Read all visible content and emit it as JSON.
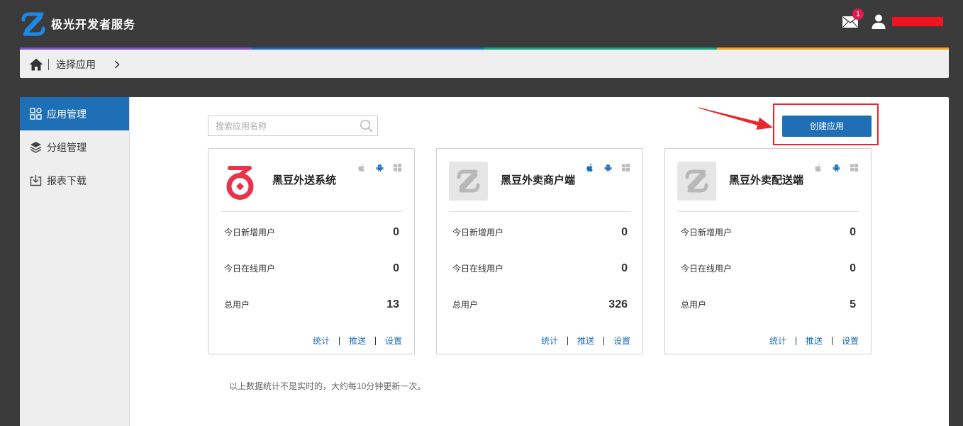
{
  "header": {
    "brand": "极光开发者服务",
    "brand_icon": "jiguang-logo-icon",
    "mail_icon": "mail-icon",
    "notification_badge": "1",
    "user_icon": "user-icon"
  },
  "breadcrumb": {
    "home_icon": "home-icon",
    "current": "选择应用",
    "chevron_icon": "chevron-right-icon"
  },
  "sidebar": {
    "items": [
      {
        "label": "应用管理",
        "icon": "app-grid-icon",
        "active": true
      },
      {
        "label": "分组管理",
        "icon": "layers-icon",
        "active": false
      },
      {
        "label": "报表下载",
        "icon": "download-icon",
        "active": false
      }
    ]
  },
  "search": {
    "placeholder": "搜索应用名称",
    "icon": "search-icon"
  },
  "create_button": {
    "label": "创建应用"
  },
  "apps": [
    {
      "name": "黑豆外送系统",
      "icon": "red-app-logo-icon",
      "platforms": {
        "ios": false,
        "android": true,
        "windows": false
      },
      "stats": [
        {
          "label": "今日新增用户",
          "value": "0"
        },
        {
          "label": "今日在线用户",
          "value": "0"
        },
        {
          "label": "总用户",
          "value": "13"
        }
      ],
      "links": [
        "统计",
        "推送",
        "设置"
      ]
    },
    {
      "name": "黑豆外卖商户端",
      "icon": "placeholder-app-logo-icon",
      "platforms": {
        "ios": true,
        "android": true,
        "windows": false
      },
      "stats": [
        {
          "label": "今日新增用户",
          "value": "0"
        },
        {
          "label": "今日在线用户",
          "value": "0"
        },
        {
          "label": "总用户",
          "value": "326"
        }
      ],
      "links": [
        "统计",
        "推送",
        "设置"
      ]
    },
    {
      "name": "黑豆外卖配送端",
      "icon": "placeholder-app-logo-icon",
      "platforms": {
        "ios": false,
        "android": true,
        "windows": false
      },
      "stats": [
        {
          "label": "今日新增用户",
          "value": "0"
        },
        {
          "label": "今日在线用户",
          "value": "0"
        },
        {
          "label": "总用户",
          "value": "5"
        }
      ],
      "links": [
        "统计",
        "推送",
        "设置"
      ]
    }
  ],
  "note": "以上数据统计不是实时的，大约每10分钟更新一次。",
  "colors": {
    "page_bg": "#3b3b3b",
    "accent_blue": "#1f6fb6",
    "platform_active": "#1f6fb6",
    "platform_inactive": "#bdbdbd",
    "annotation_red": "#e8262b",
    "stripe": [
      "#7e57c2",
      "#1f6fb6",
      "#16a085",
      "#f5a623"
    ]
  }
}
